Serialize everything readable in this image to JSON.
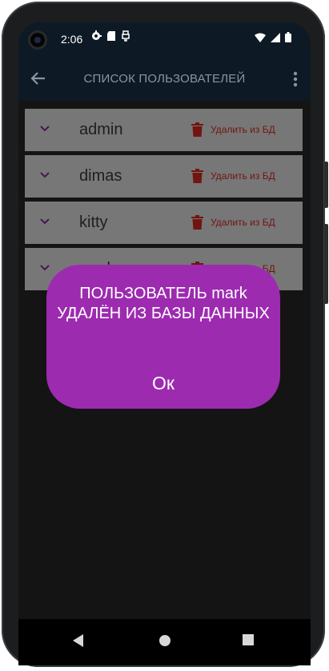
{
  "status_bar": {
    "time": "2:06",
    "icons": [
      "settings-alt-icon",
      "sd-card-icon",
      "usb-icon"
    ],
    "right_icons": [
      "wifi-icon",
      "signal-icon",
      "battery-icon"
    ]
  },
  "appbar": {
    "title": "СПИСОК ПОЛЬЗОВАТЕЛЕЙ",
    "back_icon": "arrow-back-icon",
    "menu_icon": "more-vert-icon"
  },
  "users": [
    {
      "name": "admin",
      "delete_label": "Удалить из БД"
    },
    {
      "name": "dimas",
      "delete_label": "Удалить из БД"
    },
    {
      "name": "kitty",
      "delete_label": "Удалить из БД"
    },
    {
      "name": "mark",
      "delete_label": "Удалить из БД"
    }
  ],
  "dialog": {
    "message": "ПОЛЬЗОВАТЕЛЬ mark УДАЛЁН ИЗ БАЗЫ ДАННЫХ",
    "ok_label": "Ок"
  },
  "colors": {
    "dialog_bg": "#9d2bb0",
    "row_bg": "#777777",
    "delete_red": "#701510",
    "chevron": "#4a1654",
    "appbar_bg": "#0d1a25"
  }
}
